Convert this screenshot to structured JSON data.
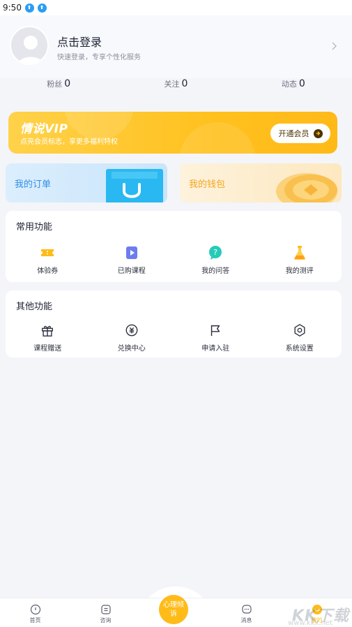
{
  "status": {
    "time": "9:50"
  },
  "profile": {
    "title": "点击登录",
    "subtitle": "快速登录，专享个性化服务"
  },
  "stats": [
    {
      "label": "粉丝",
      "value": "0"
    },
    {
      "label": "关注",
      "value": "0"
    },
    {
      "label": "动态",
      "value": "0"
    }
  ],
  "vip": {
    "title": "情说VIP",
    "subtitle": "点亮会员标志，享更多福利特权",
    "button": "开通会员"
  },
  "cards": {
    "orders": "我的订单",
    "wallet": "我的钱包"
  },
  "common": {
    "title": "常用功能",
    "items": [
      {
        "label": "体验券",
        "icon": "ticket-icon"
      },
      {
        "label": "已购课程",
        "icon": "play-icon"
      },
      {
        "label": "我的问答",
        "icon": "question-bubble-icon"
      },
      {
        "label": "我的测评",
        "icon": "flask-icon"
      }
    ]
  },
  "other": {
    "title": "其他功能",
    "items": [
      {
        "label": "课程赠送",
        "icon": "gift-icon"
      },
      {
        "label": "兑换中心",
        "icon": "exchange-icon"
      },
      {
        "label": "申请入驻",
        "icon": "flag-icon"
      },
      {
        "label": "系统设置",
        "icon": "settings-icon"
      }
    ]
  },
  "tabbar": {
    "items": [
      {
        "label": "首页",
        "icon": "home-icon"
      },
      {
        "label": "咨询",
        "icon": "consult-icon"
      },
      {
        "label": "",
        "icon": ""
      },
      {
        "label": "消息",
        "icon": "message-icon"
      },
      {
        "label": "我的",
        "icon": "profile-icon"
      }
    ],
    "center": "心理倾诉"
  },
  "watermark": {
    "main": "KK下载",
    "sub": "www.kkx.net"
  },
  "colors": {
    "accent": "#ffbb17",
    "blue": "#2e8ee8",
    "background": "#f4f5f9"
  }
}
